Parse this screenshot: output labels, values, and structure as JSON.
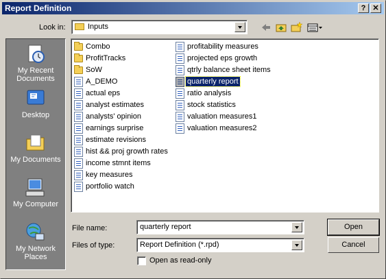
{
  "window": {
    "title": "Report Definition",
    "help_btn": "?",
    "close_btn": "✕"
  },
  "lookin": {
    "label": "Look in:",
    "value": "Inputs"
  },
  "toolbar": {
    "icons": [
      "back-icon",
      "up-folder-icon",
      "new-folder-icon",
      "view-menu-icon"
    ]
  },
  "places": [
    {
      "label": "My Recent Documents",
      "icon": "recent-documents-icon"
    },
    {
      "label": "Desktop",
      "icon": "desktop-icon"
    },
    {
      "label": "My Documents",
      "icon": "my-documents-icon"
    },
    {
      "label": "My Computer",
      "icon": "my-computer-icon"
    },
    {
      "label": "My Network Places",
      "icon": "network-places-icon"
    }
  ],
  "files": {
    "col1": [
      {
        "name": "Combo",
        "kind": "folder"
      },
      {
        "name": "ProfitTracks",
        "kind": "folder"
      },
      {
        "name": "SoW",
        "kind": "folder"
      },
      {
        "name": "A_DEMO",
        "kind": "file"
      },
      {
        "name": "actual eps",
        "kind": "file"
      },
      {
        "name": "analyst estimates",
        "kind": "file"
      },
      {
        "name": "analysts' opinion",
        "kind": "file"
      },
      {
        "name": "earnings surprise",
        "kind": "file"
      },
      {
        "name": "estimate revisions",
        "kind": "file"
      },
      {
        "name": "hist && proj growth rates",
        "kind": "file"
      },
      {
        "name": "income stmnt items",
        "kind": "file"
      },
      {
        "name": "key measures",
        "kind": "file"
      },
      {
        "name": "portfolio watch",
        "kind": "file"
      }
    ],
    "col2": [
      {
        "name": "profitability measures",
        "kind": "file"
      },
      {
        "name": "projected eps growth",
        "kind": "file"
      },
      {
        "name": "qtrly balance sheet items",
        "kind": "file"
      },
      {
        "name": "quarterly report",
        "kind": "file",
        "selected": true
      },
      {
        "name": "ratio analysis",
        "kind": "file"
      },
      {
        "name": "stock statistics",
        "kind": "file"
      },
      {
        "name": "valuation measures1",
        "kind": "file"
      },
      {
        "name": "valuation measures2",
        "kind": "file"
      }
    ]
  },
  "filename": {
    "label": "File name:",
    "value": "quarterly report"
  },
  "filetype": {
    "label": "Files of type:",
    "value": "Report Definition (*.rpd)"
  },
  "readonly": {
    "label": "Open as read-only",
    "checked": false
  },
  "buttons": {
    "open": "Open",
    "cancel": "Cancel"
  }
}
